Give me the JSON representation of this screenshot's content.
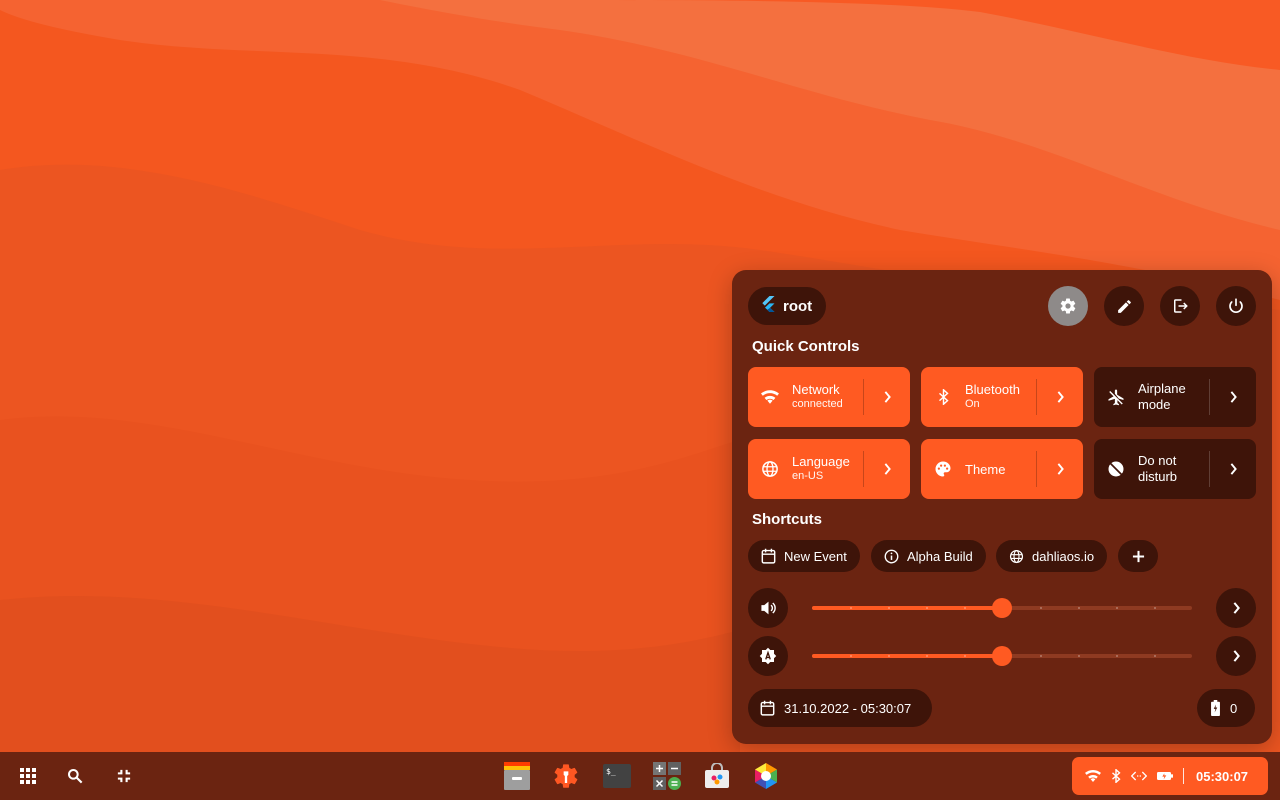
{
  "colors": {
    "accent": "#ff5a22",
    "panel": "#6b2411",
    "chip": "#3e1409",
    "wallpaper": "#f4571f"
  },
  "panel": {
    "user": {
      "icon": "flutter-logo-icon",
      "name": "root"
    },
    "header_buttons": [
      {
        "icon": "gear-icon",
        "active": true
      },
      {
        "icon": "pencil-icon",
        "active": false
      },
      {
        "icon": "logout-icon",
        "active": false
      },
      {
        "icon": "power-icon",
        "active": false
      }
    ],
    "quick_controls_title": "Quick Controls",
    "tiles": [
      {
        "icon": "wifi-icon",
        "title": "Network",
        "subtitle": "connected",
        "active": true
      },
      {
        "icon": "bluetooth-icon",
        "title": "Bluetooth",
        "subtitle": "On",
        "active": true
      },
      {
        "icon": "airplane-off-icon",
        "title": "Airplane mode",
        "subtitle": "",
        "active": false
      },
      {
        "icon": "globe-icon",
        "title": "Language",
        "subtitle": "en-US",
        "active": true
      },
      {
        "icon": "palette-icon",
        "title": "Theme",
        "subtitle": "",
        "active": true
      },
      {
        "icon": "do-not-disturb-icon",
        "title": "Do not disturb",
        "subtitle": "",
        "active": false
      }
    ],
    "shortcuts_title": "Shortcuts",
    "shortcuts": [
      {
        "icon": "calendar-icon",
        "label": "New Event"
      },
      {
        "icon": "info-icon",
        "label": "Alpha Build"
      },
      {
        "icon": "globe-icon",
        "label": "dahliaos.io"
      }
    ],
    "sliders": [
      {
        "icon": "volume-icon",
        "value": 0.5
      },
      {
        "icon": "brightness-icon",
        "value": 0.5
      }
    ],
    "datetime": "31.10.2022 - 05:30:07",
    "battery": "0"
  },
  "taskbar": {
    "left_buttons": [
      "apps-grid-icon",
      "search-icon",
      "overview-icon"
    ],
    "apps": [
      "files-icon",
      "settings-app-icon",
      "terminal-icon",
      "calculator-icon",
      "store-icon",
      "graft-icon"
    ],
    "tray": {
      "icons": [
        "wifi-icon",
        "bluetooth-icon",
        "code-icon",
        "battery-icon"
      ],
      "clock": "05:30:07"
    }
  }
}
